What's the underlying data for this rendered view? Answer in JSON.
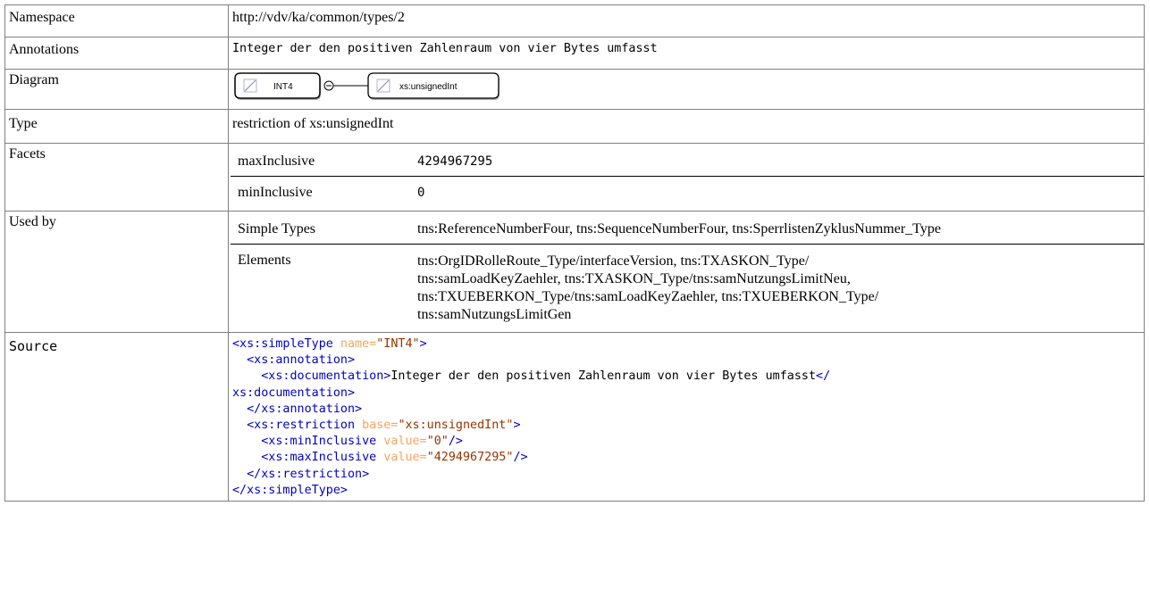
{
  "rows": {
    "namespace": {
      "label": "Namespace",
      "value": "http://vdv/ka/common/types/2"
    },
    "annotations": {
      "label": "Annotations",
      "value": "Integer der den positiven Zahlenraum von vier Bytes umfasst"
    },
    "diagram": {
      "label": "Diagram",
      "node_main": "INT4",
      "node_base": "xs:unsignedInt"
    },
    "type": {
      "label": "Type",
      "value": "restriction of xs:unsignedInt"
    },
    "facets": {
      "label": "Facets",
      "items": [
        {
          "name": "maxInclusive",
          "value": "4294967295"
        },
        {
          "name": "minInclusive",
          "value": "0"
        }
      ]
    },
    "used_by": {
      "label": "Used by",
      "simple_types": {
        "name": "Simple Types",
        "value": "tns:ReferenceNumberFour, tns:SequenceNumberFour, tns:SperrlistenZyklusNummer_Type"
      },
      "elements": {
        "name": "Elements",
        "lines": [
          "tns:OrgIDRolleRoute_Type/interfaceVersion, tns:TXASKON_Type/",
          "tns:samLoadKeyZaehler, tns:TXASKON_Type/tns:samNutzungsLimitNeu,",
          "tns:TXUEBERKON_Type/tns:samLoadKeyZaehler, tns:TXUEBERKON_Type/",
          "tns:samNutzungsLimitGen"
        ]
      }
    },
    "source": {
      "label": "Source",
      "l1_tag": "<xs:simpleType",
      "l1_attr": " name=",
      "l1_val": "\"INT4\"",
      "l1_end": ">",
      "l2": "  <xs:annotation>",
      "l3_tag": "    <xs:documentation>",
      "l3_text": "Integer der den positiven Zahlenraum von vier Bytes umfasst",
      "l3_end": "</",
      "l4": "xs:documentation>",
      "l5": "  </xs:annotation>",
      "l6_tag": "  <xs:restriction",
      "l6_attr": " base=",
      "l6_val": "\"xs:unsignedInt\"",
      "l6_end": ">",
      "l7_tag": "    <xs:minInclusive",
      "l7_attr": " value=",
      "l7_val": "\"0\"",
      "l7_end": "/>",
      "l8_tag": "    <xs:maxInclusive",
      "l8_attr": " value=",
      "l8_val": "\"4294967295\"",
      "l8_end": "/>",
      "l9": "  </xs:restriction>",
      "l10": "</xs:simpleType>"
    }
  },
  "colors": {
    "tag": "#0000cc",
    "attribute": "#f4a460",
    "attribute_value": "#993300",
    "border": "#808080"
  },
  "icons": {
    "diagram_node": "pencil-icon",
    "connector": "sequence-connector-icon"
  }
}
